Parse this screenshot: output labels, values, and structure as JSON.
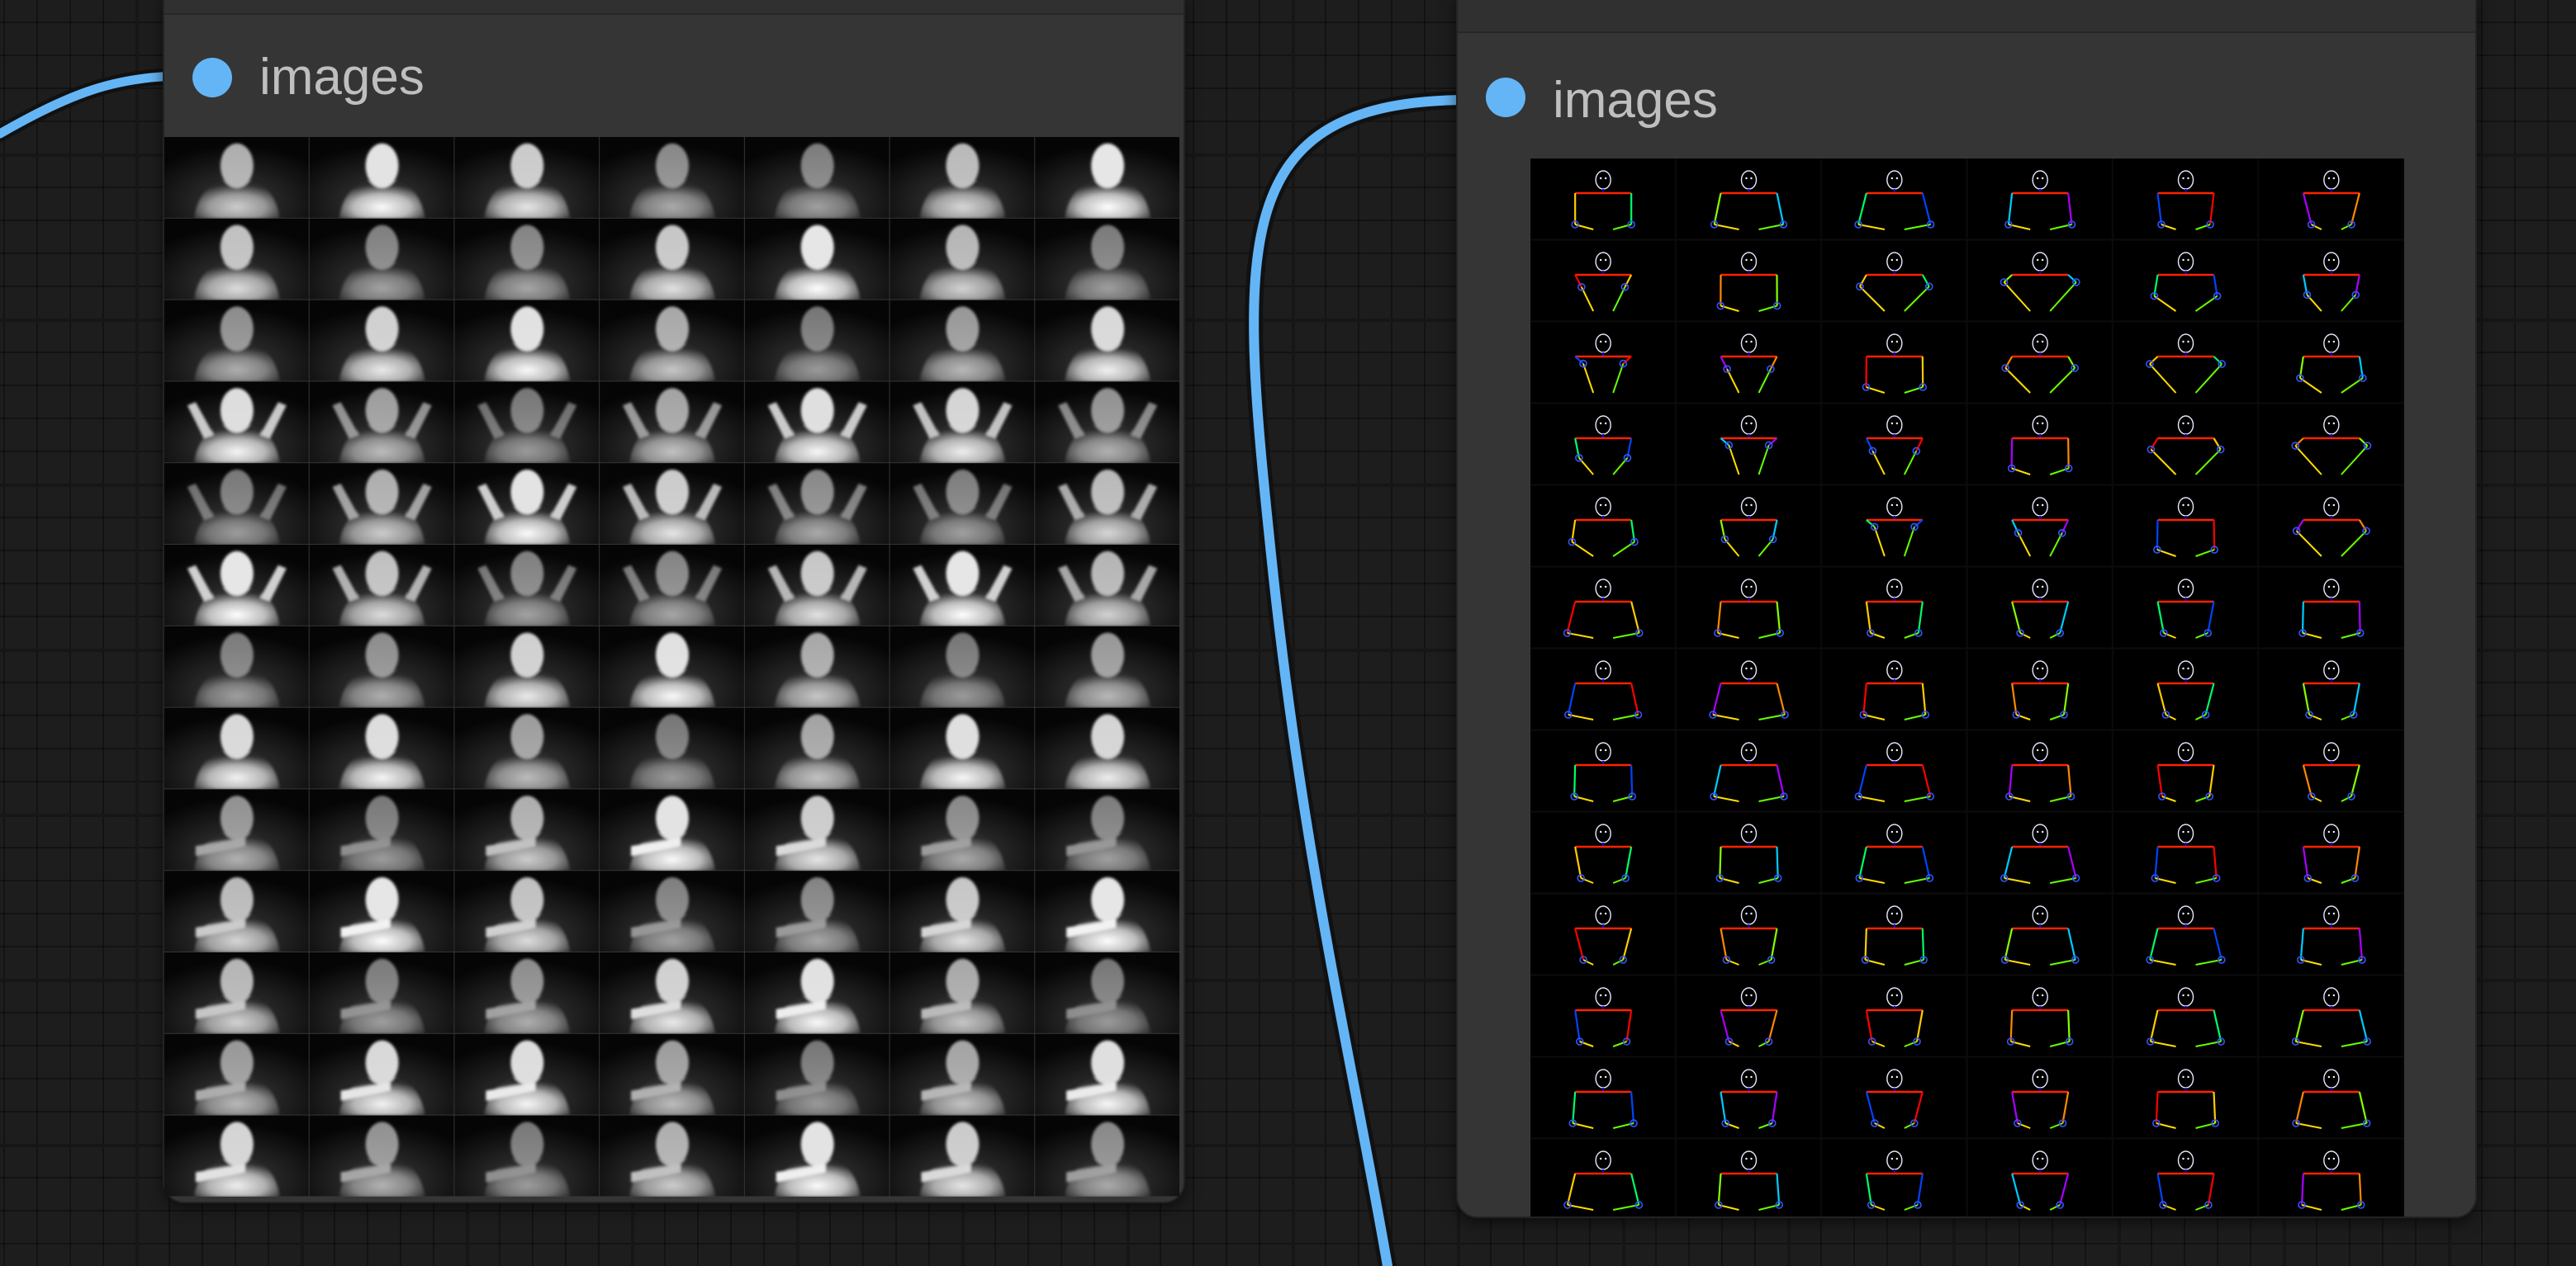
{
  "left_node": {
    "output_label": "images",
    "output_type_color": "#64b5f6",
    "preview": {
      "kind": "depth-map-grid",
      "columns": 7,
      "frame_count": 97
    }
  },
  "right_node": {
    "output_label": "images",
    "output_type_color": "#64b5f6",
    "preview": {
      "kind": "openpose-skeleton-grid",
      "columns": 6
    }
  },
  "link": {
    "color": "#64b5f6"
  }
}
